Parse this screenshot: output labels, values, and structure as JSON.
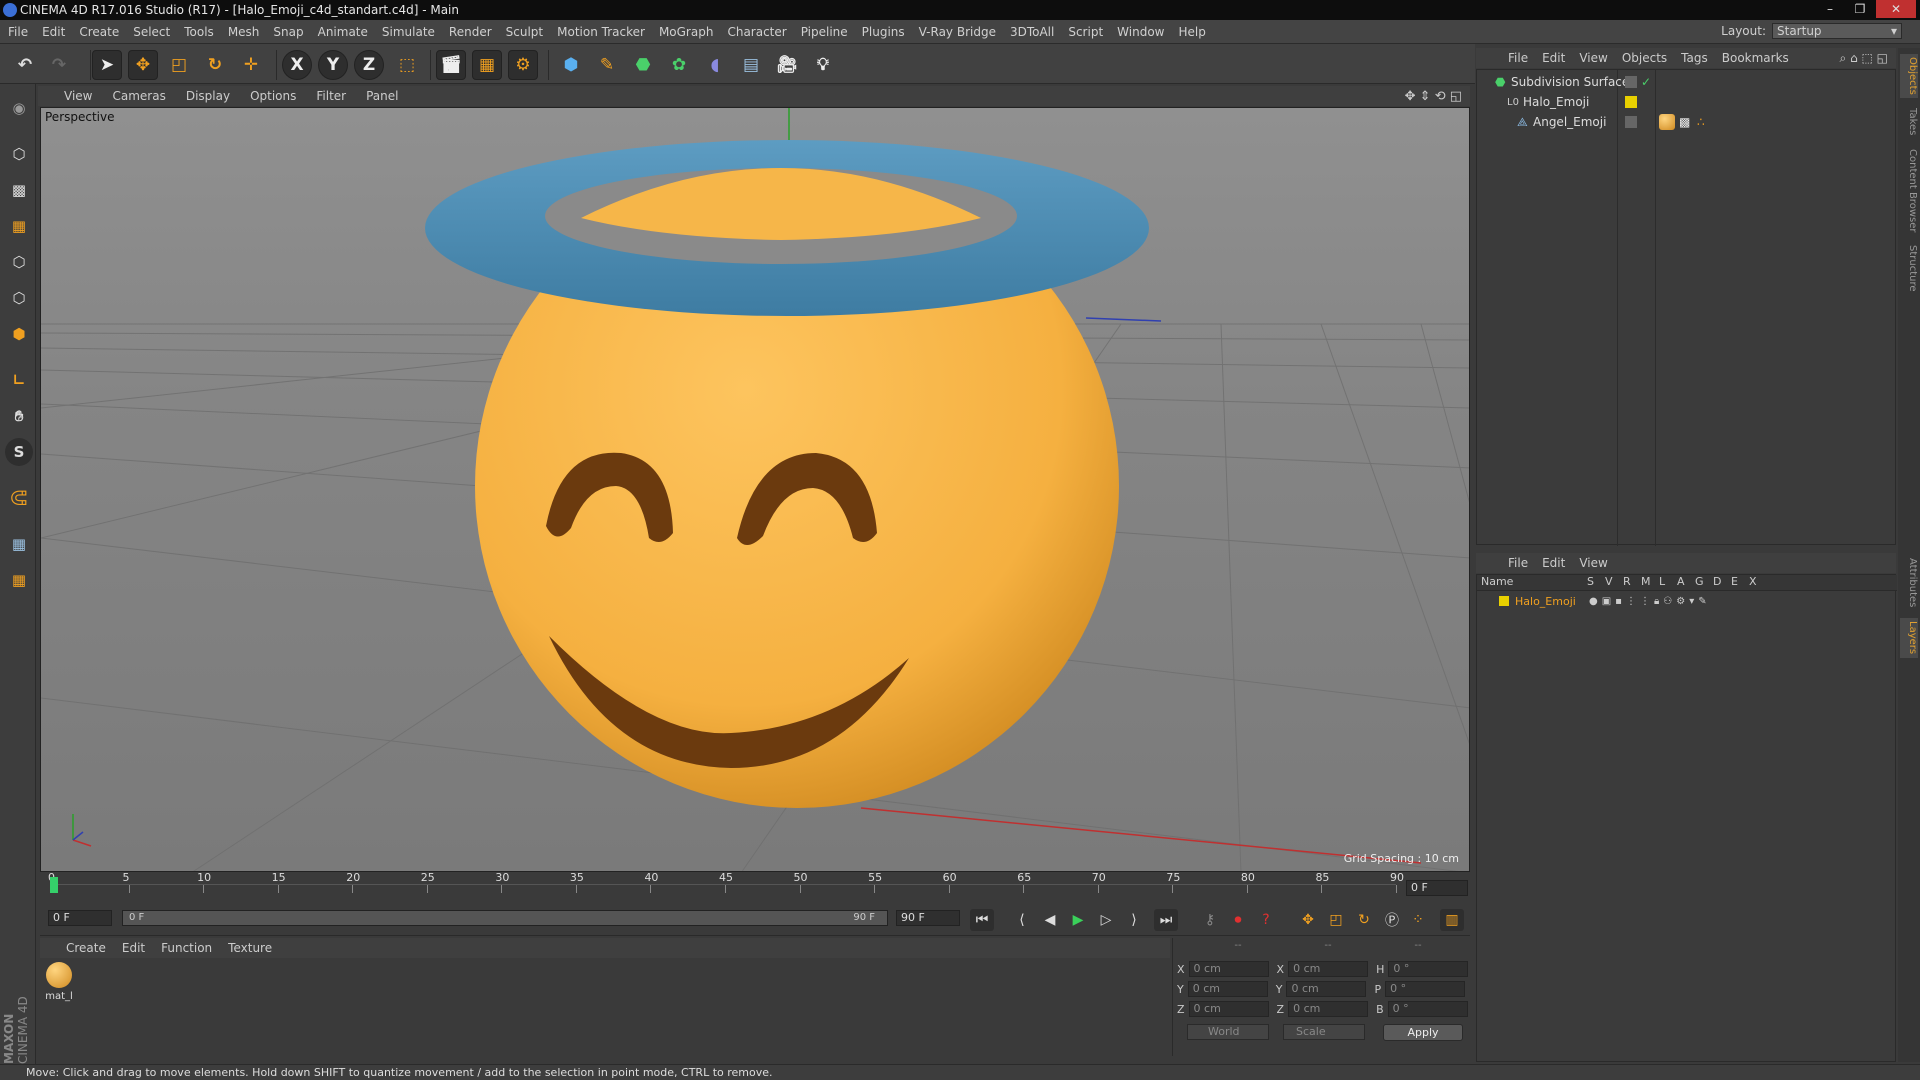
{
  "window": {
    "title": "CINEMA 4D R17.016 Studio (R17) - [Halo_Emoji_c4d_standart.c4d] - Main",
    "controls": [
      "–",
      "❐",
      "✕"
    ]
  },
  "menubar": {
    "items": [
      "File",
      "Edit",
      "Create",
      "Select",
      "Tools",
      "Mesh",
      "Snap",
      "Animate",
      "Simulate",
      "Render",
      "Sculpt",
      "Motion Tracker",
      "MoGraph",
      "Character",
      "Pipeline",
      "Plugins",
      "V-Ray Bridge",
      "3DToAll",
      "Script",
      "Window",
      "Help"
    ],
    "layout_label": "Layout:",
    "layout_value": "Startup"
  },
  "toolbar": {
    "axis_x": "X",
    "axis_y": "Y",
    "axis_z": "Z"
  },
  "viewport": {
    "menu": [
      "View",
      "Cameras",
      "Display",
      "Options",
      "Filter",
      "Panel"
    ],
    "label": "Perspective",
    "grid_spacing": "Grid Spacing : 10 cm"
  },
  "timeline": {
    "ticks": [
      "0",
      "5",
      "10",
      "15",
      "20",
      "25",
      "30",
      "35",
      "40",
      "45",
      "50",
      "55",
      "60",
      "65",
      "70",
      "75",
      "80",
      "85",
      "90"
    ],
    "current_frame_right": "0 F",
    "start_field": "0 F",
    "range_left": "0 F",
    "range_right": "90 F",
    "end_field": "90 F"
  },
  "material_manager": {
    "menu": [
      "Create",
      "Edit",
      "Function",
      "Texture"
    ],
    "materials": [
      {
        "name": "mat_l"
      }
    ]
  },
  "coordinates": {
    "header": [
      "--",
      "--",
      "--"
    ],
    "rows": [
      {
        "a": "X",
        "av": "0 cm",
        "b": "X",
        "bv": "0 cm",
        "c": "H",
        "cv": "0 °"
      },
      {
        "a": "Y",
        "av": "0 cm",
        "b": "Y",
        "bv": "0 cm",
        "c": "P",
        "cv": "0 °"
      },
      {
        "a": "Z",
        "av": "0 cm",
        "b": "Z",
        "bv": "0 cm",
        "c": "B",
        "cv": "0 °"
      }
    ],
    "mode": "World",
    "size_mode": "Scale",
    "apply": "Apply"
  },
  "object_manager": {
    "menu": [
      "File",
      "Edit",
      "View",
      "Objects",
      "Tags",
      "Bookmarks"
    ],
    "objects": [
      {
        "name": "Subdivision Surface"
      },
      {
        "name": "Halo_Emoji"
      },
      {
        "name": "Angel_Emoji"
      }
    ]
  },
  "layer_manager": {
    "menu": [
      "File",
      "Edit",
      "View"
    ],
    "columns": [
      "Name",
      "S",
      "V",
      "R",
      "M",
      "L",
      "A",
      "G",
      "D",
      "E",
      "X"
    ],
    "layers": [
      {
        "name": "Halo_Emoji"
      }
    ]
  },
  "side_tabs": [
    "Objects",
    "Takes",
    "Content Browser",
    "Structure",
    "Attributes",
    "Layers"
  ],
  "branding": {
    "maxon": "MAXON",
    "product": "CINEMA 4D"
  },
  "status": "Move: Click and drag to move elements. Hold down SHIFT to quantize movement / add to the selection in point mode, CTRL to remove.",
  "colors": {
    "accent": "#f0a020",
    "emoji": "#f5b344",
    "halo": "#4e8fb6",
    "eyes": "#6b3a0e",
    "layer_dot": "#e8d000"
  }
}
